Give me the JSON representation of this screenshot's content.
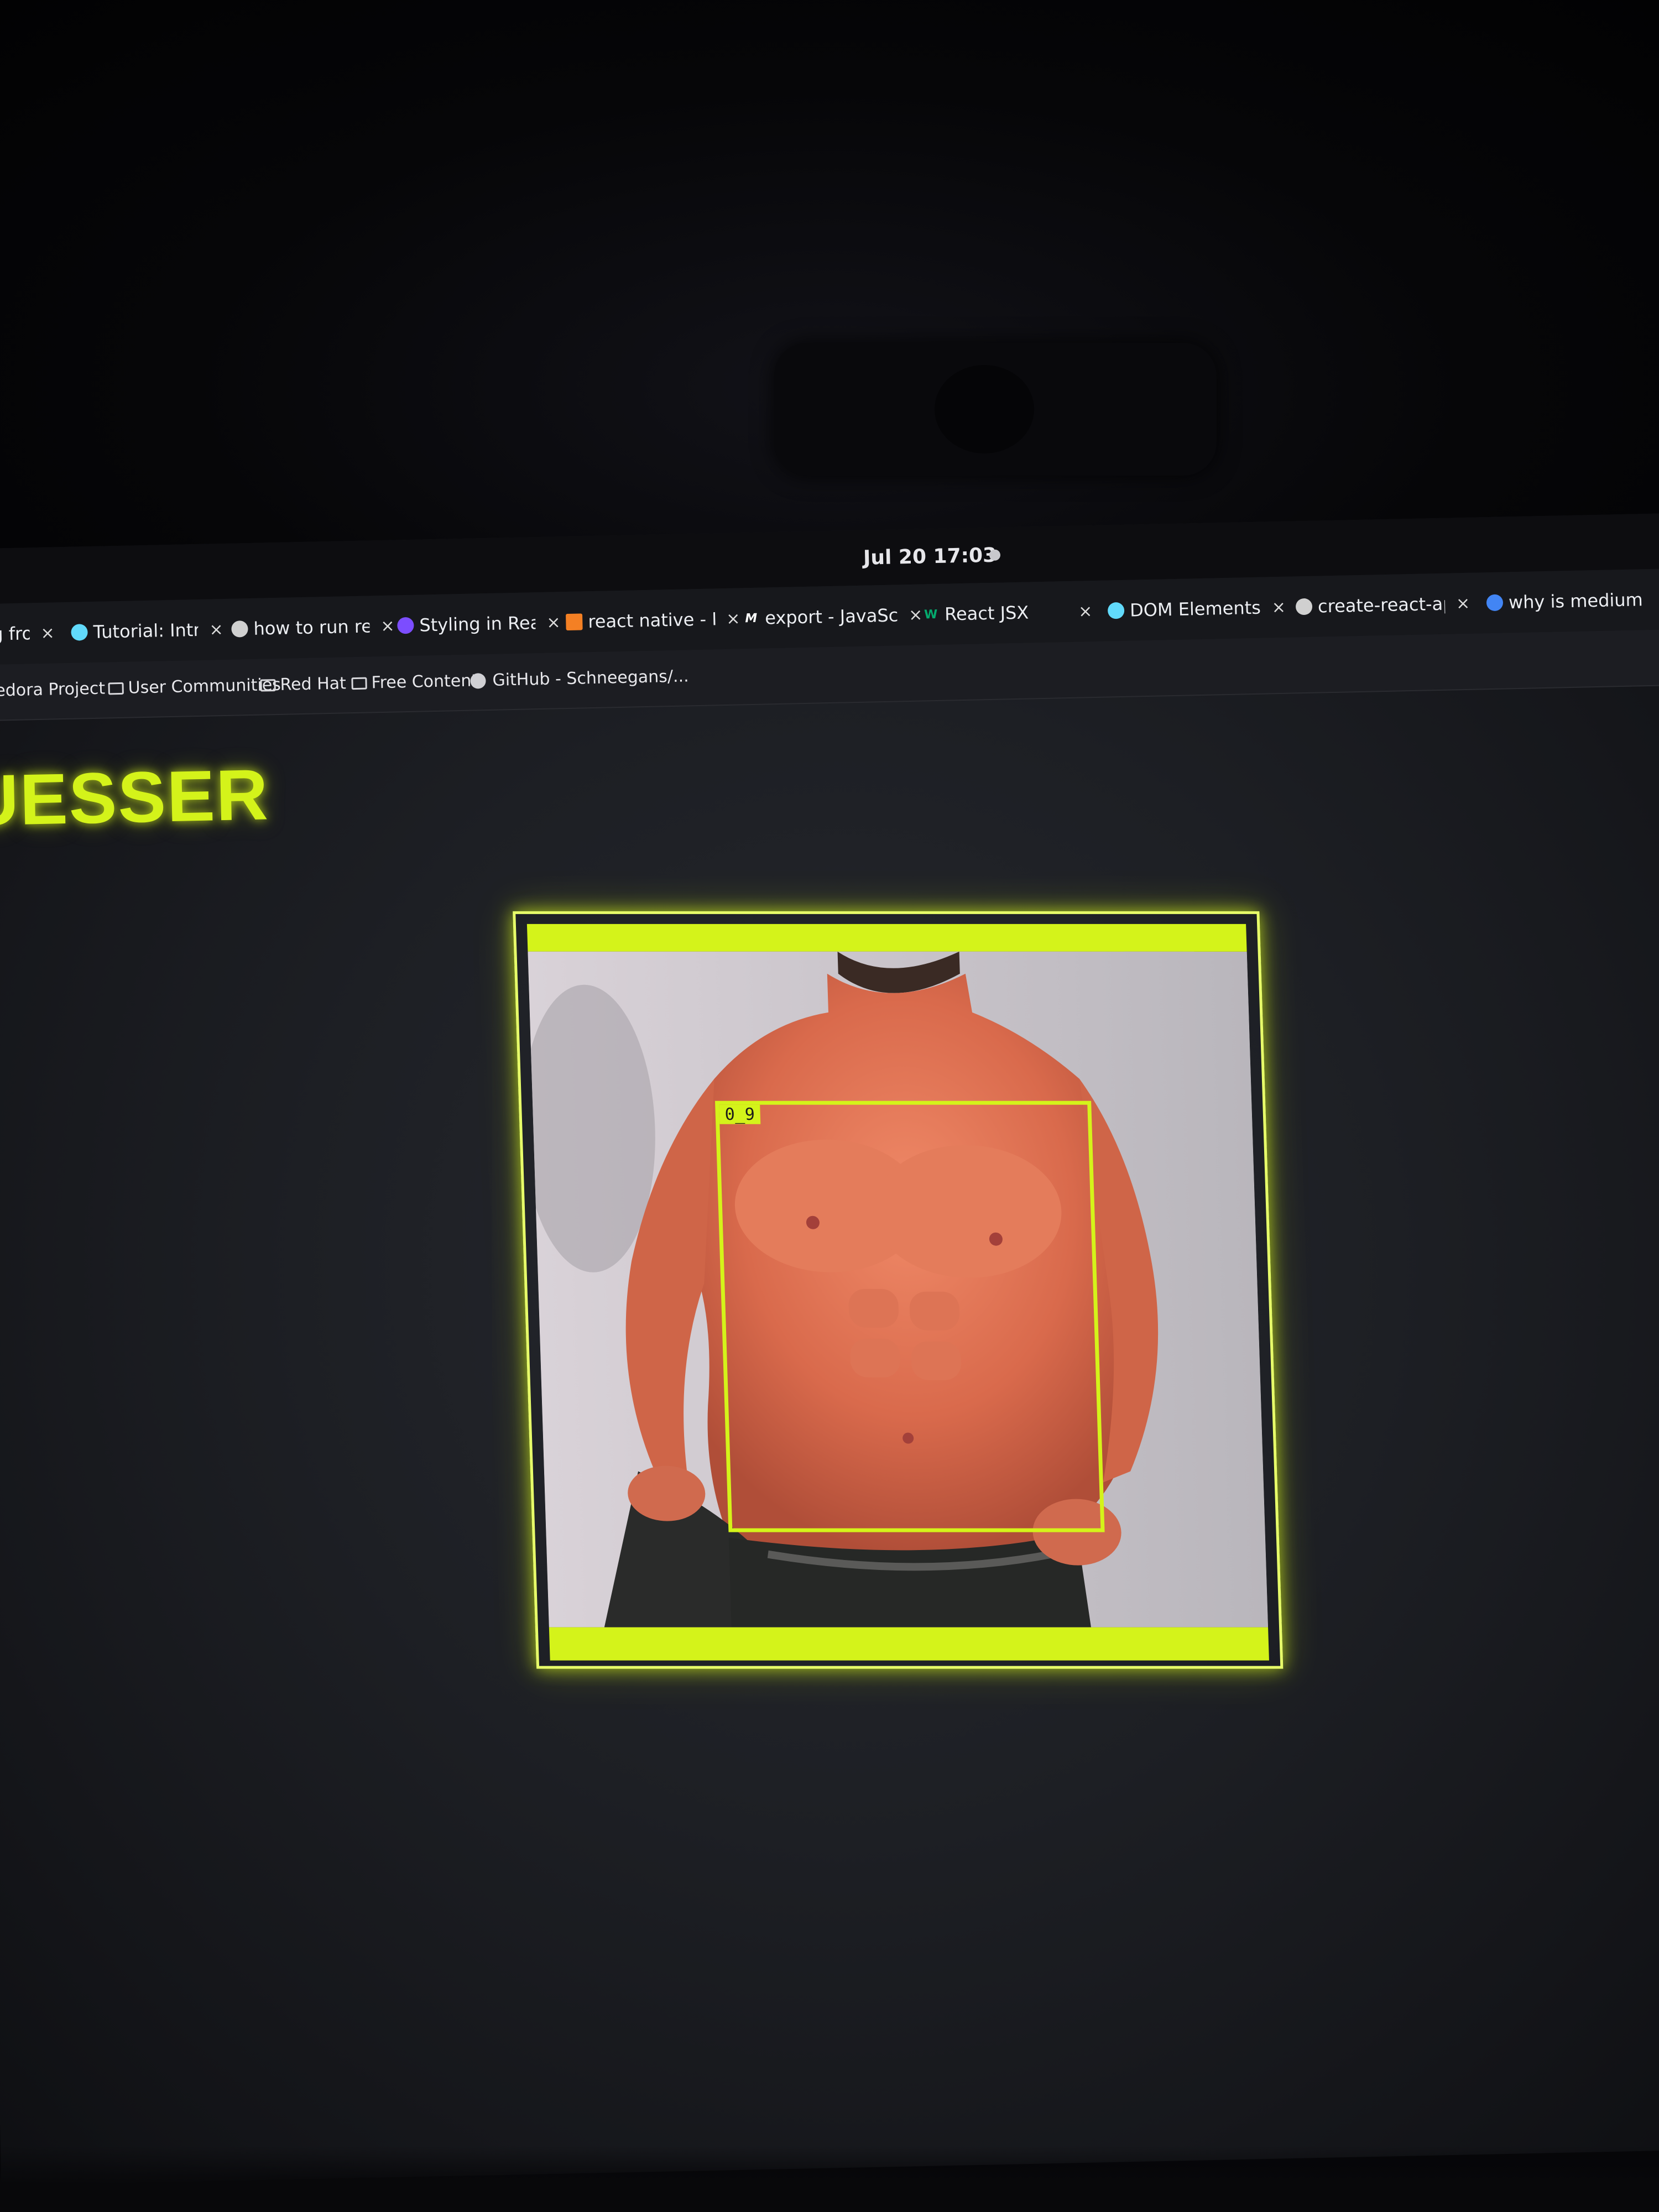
{
  "topbar": {
    "clock": "Jul 20  17:03"
  },
  "tabs": [
    {
      "label": "ting from",
      "icon": "generic-page-icon",
      "favicon_color": "#777777"
    },
    {
      "label": "Tutorial: Intro t",
      "icon": "react-icon",
      "favicon_color": "#61dafb"
    },
    {
      "label": "how to run reac",
      "icon": "github-icon",
      "favicon_color": "#d0d0d0"
    },
    {
      "label": "Styling in React",
      "icon": "styled-icon",
      "favicon_color": "#7c4dff"
    },
    {
      "label": "react native - Ir",
      "icon": "stackoverflow-icon",
      "favicon_color": "#f48024"
    },
    {
      "label": "export - JavaScr",
      "icon": "mdn-icon",
      "favicon_color": "#ffffff"
    },
    {
      "label": "React JSX",
      "icon": "w3schools-icon",
      "favicon_color": "#04aa6d"
    },
    {
      "label": "DOM Elements",
      "icon": "react-icon",
      "favicon_color": "#61dafb"
    },
    {
      "label": "create-react-ap",
      "icon": "github-icon",
      "favicon_color": "#d0d0d0"
    },
    {
      "label": "why is medium",
      "icon": "google-icon",
      "favicon_color": "#4285f4"
    }
  ],
  "bookmarks": [
    {
      "label": "Fedora Project",
      "icon": "fedora-icon"
    },
    {
      "label": "User Communities",
      "icon": "folder-icon"
    },
    {
      "label": "Red Hat",
      "icon": "folder-icon"
    },
    {
      "label": "Free Content",
      "icon": "folder-icon"
    },
    {
      "label": "GitHub - Schneegans/...",
      "icon": "github-icon"
    }
  ],
  "app": {
    "title": "UESSER",
    "accent_color": "#d4f31a"
  },
  "detection": {
    "label": "0_9"
  }
}
